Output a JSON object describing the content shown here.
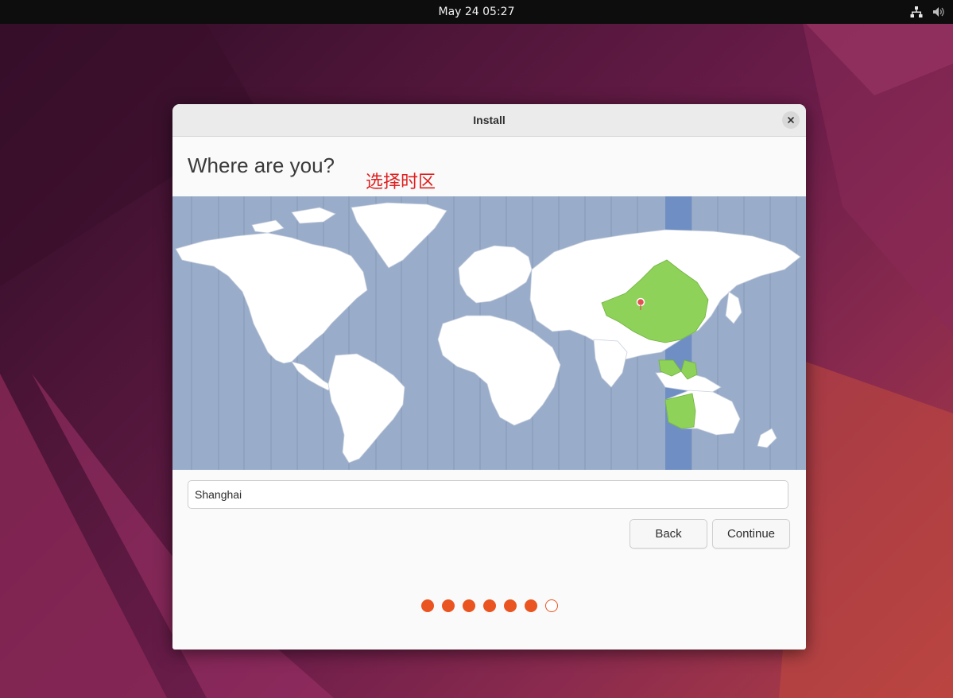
{
  "topbar": {
    "datetime": "May 24  05:27",
    "tray_icons": [
      "network-icon",
      "volume-muted-icon"
    ]
  },
  "window": {
    "title": "Install",
    "heading": "Where are you?",
    "annotation": "选择时区"
  },
  "timezone": {
    "field_value": "Shanghai",
    "selected_marker": "Shanghai"
  },
  "buttons": {
    "back_label": "Back",
    "continue_label": "Continue"
  },
  "progress": {
    "total_steps": 7,
    "completed_steps": 6
  },
  "colors": {
    "accent": "#e95420",
    "map_ocean": "#99acc9",
    "selected_region": "#8fd25a",
    "selected_band": "#6f8fc4",
    "land": "#ffffff"
  }
}
